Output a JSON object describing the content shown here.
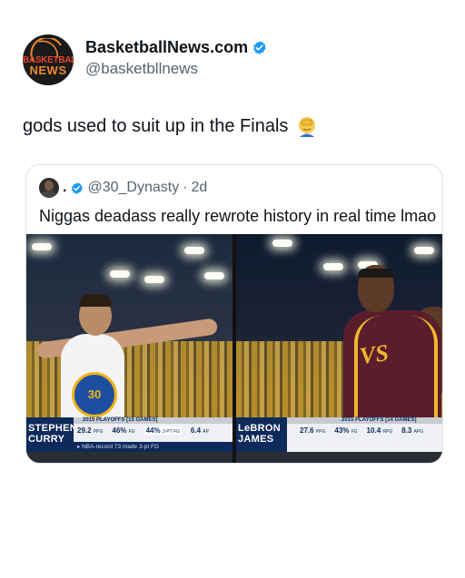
{
  "author": {
    "name": "BasketballNews.com",
    "handle": "@basketbllnews",
    "logo_line1": "BASKETBALL",
    "logo_line2": "NEWS",
    "verified": true
  },
  "post": {
    "text": "gods used to suit up in the Finals",
    "emoji": "face-palm-emoji"
  },
  "quote": {
    "name": ".",
    "handle": "@30_Dynasty",
    "separator": "·",
    "time": "2d",
    "text": "Niggas deadass really rewrote history in real time lmao",
    "media": {
      "left": {
        "player": "STEPHEN CURRY",
        "player_line1": "STEPHEN",
        "player_line2": "CURRY",
        "jersey": "30",
        "header": "2015 PLAYOFFS [15 GAMES]",
        "ppg": "29.2",
        "ppg_unit": "PPG",
        "fg": "46%",
        "fg_unit": "FG",
        "three": "44%",
        "three_unit": "3-PT FG",
        "apg": "6.4",
        "apg_unit": "AP",
        "note": "NBA-record 73 made 3-pt FG"
      },
      "right": {
        "player": "LeBRON JAMES",
        "player_line1": "LeBRON",
        "player_line2": "JAMES",
        "header": "2015 PLAYOFFS [14 GAMES]",
        "ppg": "27.6",
        "ppg_unit": "PPG",
        "fg": "43%",
        "fg_unit": "FG",
        "rpg": "10.4",
        "rpg_unit": "RPG",
        "apg": "8.3",
        "apg_unit": "APG"
      }
    }
  },
  "colors": {
    "verified_blue": "#1d9bf0",
    "text_primary": "#0f1419",
    "text_secondary": "#536471",
    "border": "#dfe3e7"
  }
}
